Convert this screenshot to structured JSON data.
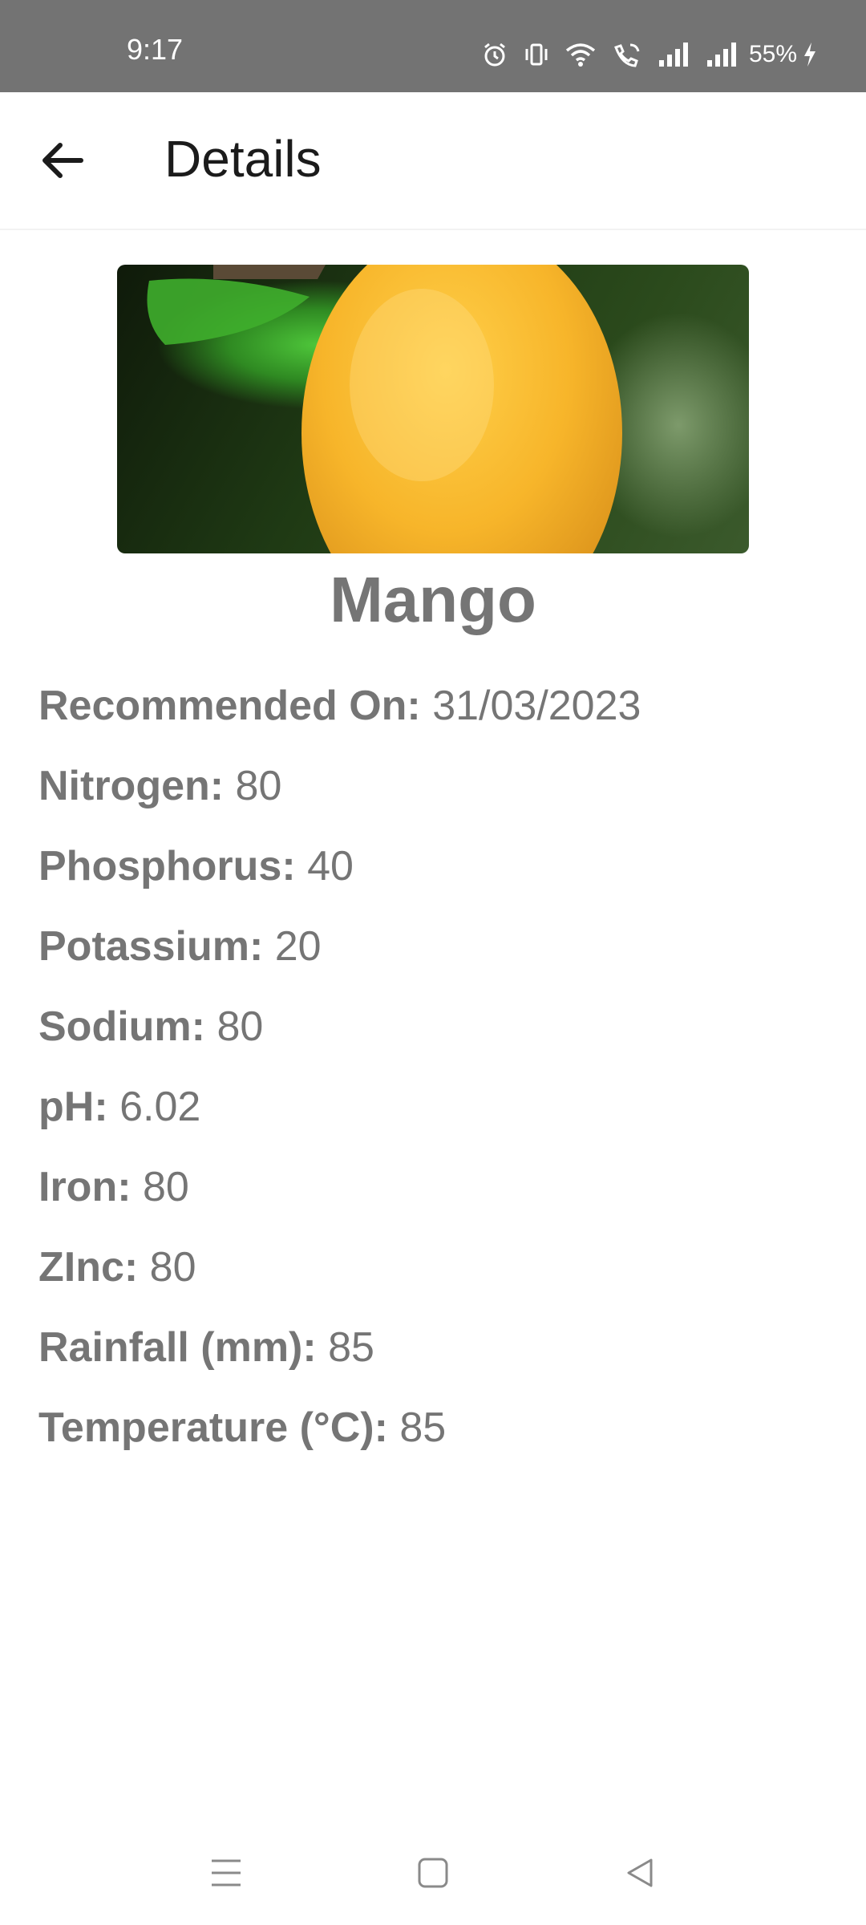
{
  "status_bar": {
    "time": "9:17",
    "battery": "55%"
  },
  "app_bar": {
    "title": "Details",
    "back_icon": "arrow-left-icon"
  },
  "crop": {
    "name": "Mango",
    "image": "mango-photo"
  },
  "details": [
    {
      "label": "Recommended On:",
      "value": "31/03/2023"
    },
    {
      "label": "Nitrogen:",
      "value": "80"
    },
    {
      "label": "Phosphorus:",
      "value": "40"
    },
    {
      "label": "Potassium:",
      "value": "20"
    },
    {
      "label": "Sodium:",
      "value": "80"
    },
    {
      "label": "pH:",
      "value": "6.02"
    },
    {
      "label": "Iron:",
      "value": "80"
    },
    {
      "label": "ZInc:",
      "value": "80"
    },
    {
      "label": "Rainfall (mm):",
      "value": "85"
    },
    {
      "label": "Temperature (°C):",
      "value": "85"
    }
  ],
  "nav_bar": {
    "icons": [
      "menu-icon",
      "home-square-icon",
      "back-triangle-icon"
    ]
  },
  "colors": {
    "status_bar_bg": "#737373",
    "text_gray": "#757575",
    "title_dark": "#1b1b1b"
  }
}
